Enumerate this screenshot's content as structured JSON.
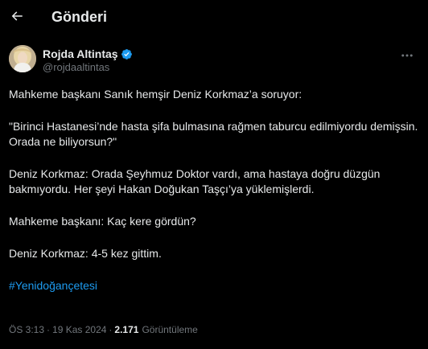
{
  "header": {
    "title": "Gönderi"
  },
  "author": {
    "display_name": "Rojda Altintaş",
    "handle": "@rojdaaltintas",
    "verified_color": "#1d9bf0"
  },
  "tweet": {
    "paragraphs": [
      "Mahkeme başkanı Sanık hemşir Deniz Korkmaz’a soruyor:",
      "\"Birinci Hastanesi’nde hasta şifa bulmasına rağmen taburcu edilmiyordu demişsin. Orada ne biliyorsun?\"",
      "Deniz Korkmaz: Orada Şeyhmuz Doktor vardı, ama hastaya doğru düzgün bakmıyordu. Her şeyi Hakan Doğukan Taşçı’ya yüklemişlerdi.",
      "Mahkeme başkanı: Kaç kere gördün?",
      "Deniz Korkmaz: 4-5 kez gittim."
    ],
    "hashtag": "#Yenidoğançetesi"
  },
  "meta": {
    "time": "ÖS 3:13",
    "dot1": "·",
    "date": "19 Kas 2024",
    "dot2": "·",
    "views_count": "2.171",
    "views_label": "Görüntüleme"
  },
  "colors": {
    "background": "#000000",
    "text": "#e7e9ea",
    "muted": "#71767b",
    "accent": "#1d9bf0"
  },
  "icons": {
    "back": "arrow-left-icon",
    "verified": "verified-badge-icon",
    "more": "more-horizontal-icon"
  }
}
